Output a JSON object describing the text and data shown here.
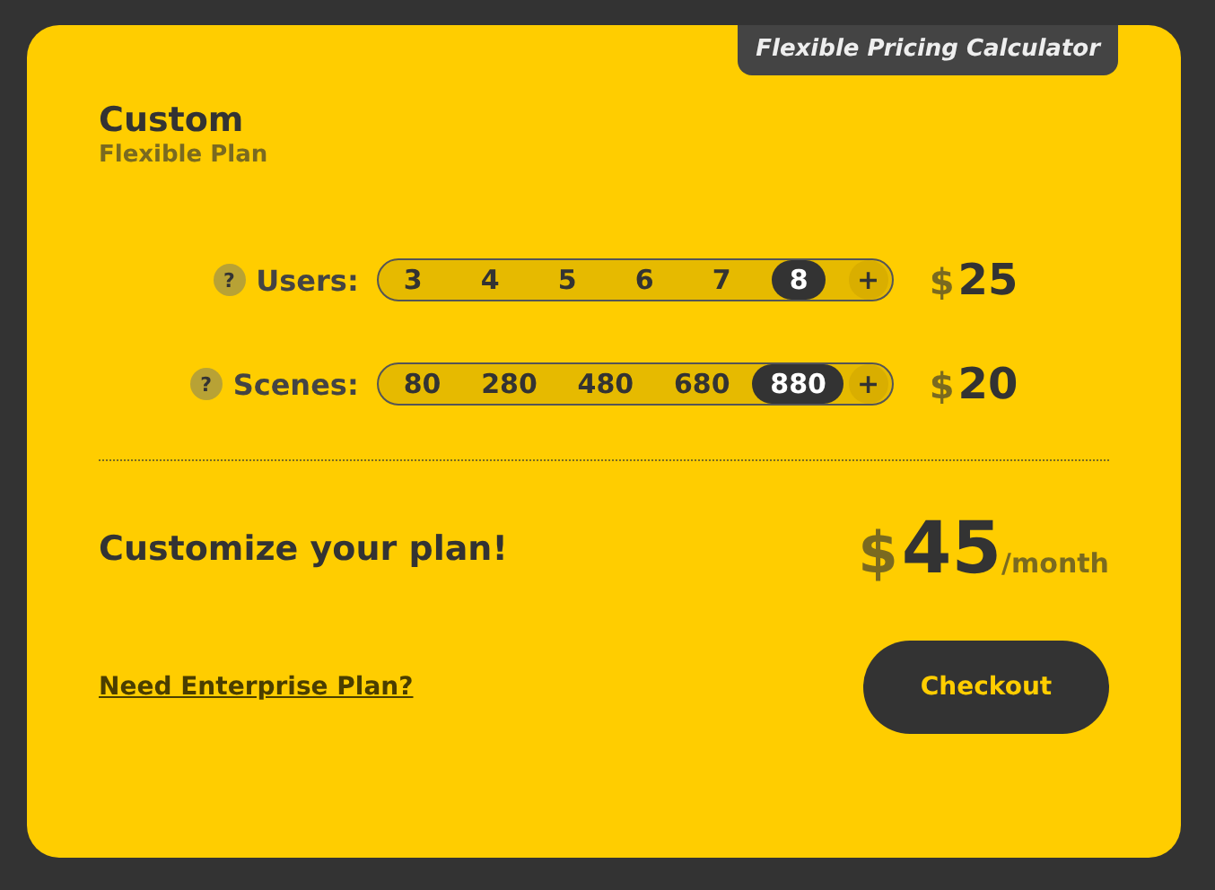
{
  "badge": "Flexible Pricing Calculator",
  "plan": {
    "title": "Custom",
    "subtitle": "Flexible Plan"
  },
  "selectors": [
    {
      "help": "?",
      "label": "Users:",
      "options": [
        {
          "label": "3",
          "selected": false
        },
        {
          "label": "4",
          "selected": false
        },
        {
          "label": "5",
          "selected": false
        },
        {
          "label": "6",
          "selected": false
        },
        {
          "label": "7",
          "selected": false
        },
        {
          "label": "8",
          "selected": true
        }
      ],
      "more": "+",
      "currency": "$",
      "price": "25"
    },
    {
      "help": "?",
      "label": "Scenes:",
      "options": [
        {
          "label": "80",
          "selected": false
        },
        {
          "label": "280",
          "selected": false
        },
        {
          "label": "480",
          "selected": false
        },
        {
          "label": "680",
          "selected": false
        },
        {
          "label": "880",
          "selected": true
        }
      ],
      "more": "+",
      "currency": "$",
      "price": "20"
    }
  ],
  "summary": {
    "heading": "Customize your plan!",
    "currency": "$",
    "amount": "45",
    "period": "/month"
  },
  "link": "Need Enterprise Plan?",
  "checkout": "Checkout"
}
